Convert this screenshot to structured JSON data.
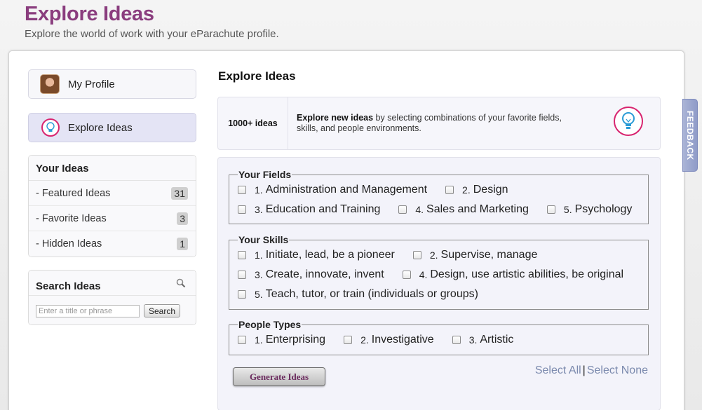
{
  "header": {
    "title": "Explore Ideas",
    "subtitle": "Explore the world of work with your eParachute profile."
  },
  "sidebar": {
    "nav": [
      {
        "label": "My Profile",
        "icon": "avatar"
      },
      {
        "label": "Explore Ideas",
        "icon": "lightbulb-icon",
        "active": true
      }
    ],
    "your_ideas": {
      "title": "Your Ideas",
      "items": [
        {
          "label": "- Featured Ideas",
          "count": "31"
        },
        {
          "label": "- Favorite Ideas",
          "count": "3"
        },
        {
          "label": "- Hidden Ideas",
          "count": "1"
        }
      ]
    },
    "search": {
      "title": "Search Ideas",
      "placeholder": "Enter a title or phrase",
      "button_label": "Search",
      "icon": "magnifier-icon"
    }
  },
  "main": {
    "title": "Explore Ideas",
    "intro": {
      "count": "1000+ ideas",
      "bold": "Explore new ideas",
      "text": " by selecting combinations of your favorite fields, skills, and people environments."
    },
    "fields": {
      "legend": "Your Fields",
      "rows": [
        [
          {
            "num": "1.",
            "label": "Administration and Management"
          },
          {
            "num": "2.",
            "label": "Design"
          }
        ],
        [
          {
            "num": "3.",
            "label": "Education and Training"
          },
          {
            "num": "4.",
            "label": "Sales and Marketing"
          },
          {
            "num": "5.",
            "label": "Psychology"
          }
        ]
      ]
    },
    "skills": {
      "legend": "Your Skills",
      "rows": [
        [
          {
            "num": "1.",
            "label": "Initiate, lead, be a pioneer"
          },
          {
            "num": "2.",
            "label": "Supervise, manage"
          }
        ],
        [
          {
            "num": "3.",
            "label": "Create, innovate, invent"
          },
          {
            "num": "4.",
            "label": "Design, use artistic abilities, be original"
          }
        ],
        [
          {
            "num": "5.",
            "label": "Teach, tutor, or train (individuals or groups)"
          }
        ]
      ]
    },
    "people": {
      "legend": "People Types",
      "rows": [
        [
          {
            "num": "1.",
            "label": "Enterprising"
          },
          {
            "num": "2.",
            "label": "Investigative"
          },
          {
            "num": "3.",
            "label": "Artistic"
          }
        ]
      ]
    },
    "generate_label": "Generate Ideas",
    "select_all": "Select All",
    "separator": "|",
    "select_none": "Select None"
  },
  "feedback_label": "FEEDBACK",
  "colors": {
    "brand": "#8a3d7e",
    "accent_pink": "#d8246f",
    "link": "#7a89ad"
  }
}
